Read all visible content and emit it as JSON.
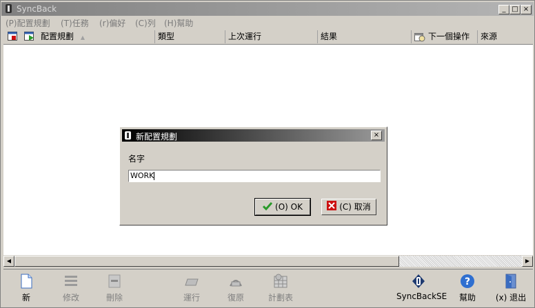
{
  "window": {
    "title": "SyncBack",
    "buttons": [
      "_",
      "□",
      "×"
    ]
  },
  "menu": [
    {
      "label": "(P)配置規劃"
    },
    {
      "label": "(T)任務"
    },
    {
      "label": "(r)偏好"
    },
    {
      "label": "(C)列"
    },
    {
      "label": "(H)幫助"
    }
  ],
  "list": {
    "columns": [
      {
        "label": "配置規劃"
      },
      {
        "label": "類型"
      },
      {
        "label": "上次運行"
      },
      {
        "label": "結果"
      },
      {
        "label": "下一個操作"
      },
      {
        "label": "來源"
      }
    ],
    "sort_indicator": "▲",
    "rows": []
  },
  "dialog": {
    "title": "新配置規劃",
    "name_label": "名字",
    "name_value": "WORK",
    "ok_label": "(O) OK",
    "cancel_label": "(C) 取消",
    "close_glyph": "×"
  },
  "toolbar": {
    "new": "新",
    "modify": "修改",
    "delete": "刪除",
    "run": "運行",
    "restore": "復原",
    "schedule": "計劃表",
    "syncbackse": "SyncBackSE",
    "help": "幫助",
    "exit": "(x) 退出"
  },
  "colors": {
    "accent_green": "#2a9a2a",
    "accent_red": "#cc1111",
    "help_blue": "#2f6fd0"
  }
}
